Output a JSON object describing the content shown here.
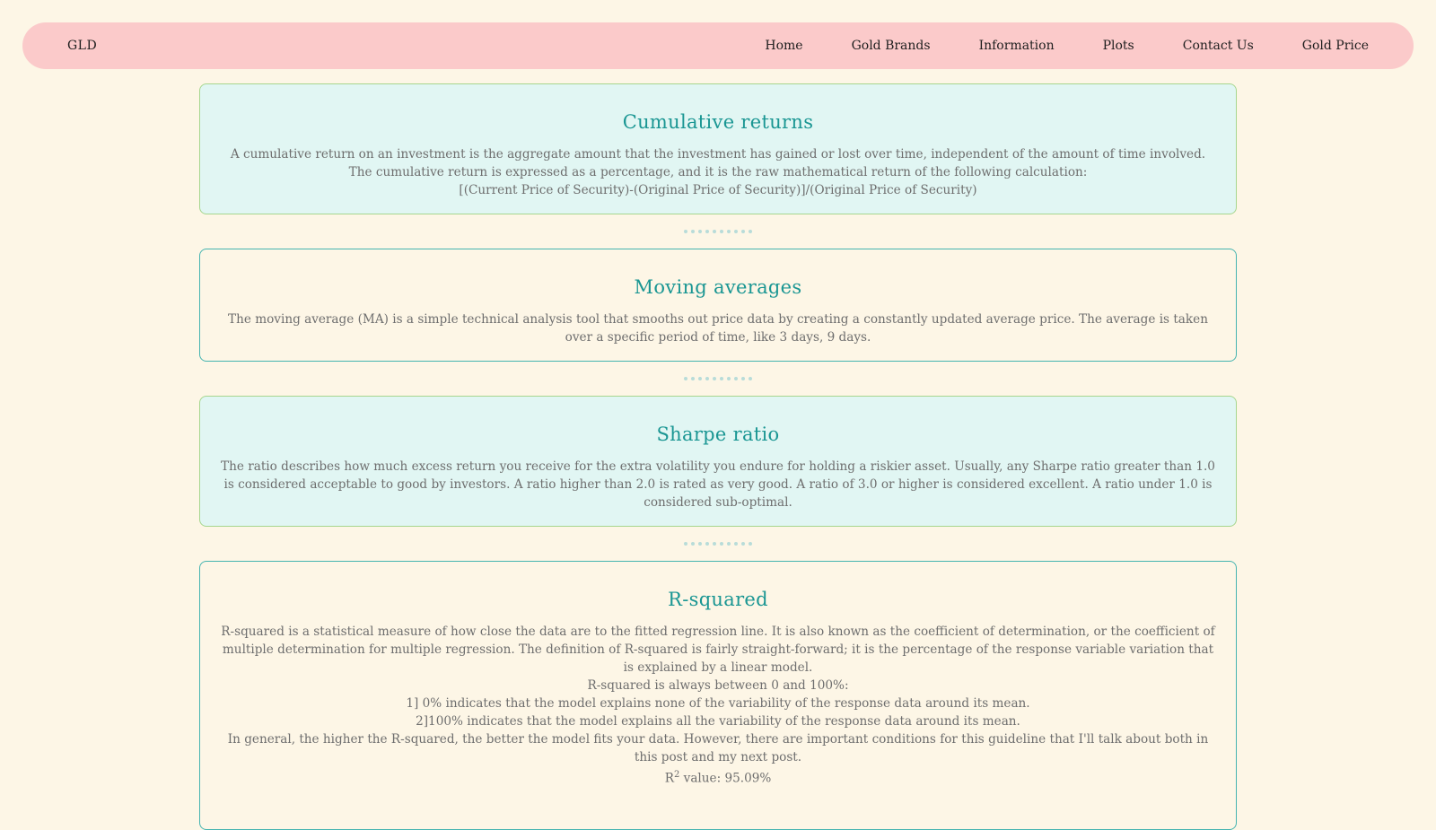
{
  "nav": {
    "brand": "GLD",
    "links": [
      "Home",
      "Gold Brands",
      "Information",
      "Plots",
      "Contact Us",
      "Gold Price"
    ]
  },
  "cards": {
    "cumulative": {
      "title": "Cumulative returns",
      "text": "A cumulative return on an investment is the aggregate amount that the investment has gained or lost over time, independent of the amount of time involved. The cumulative return is expressed as a percentage, and it is the raw mathematical return of the following calculation:",
      "formula": "[(Current Price of Security)-(Original Price of Security)]/(Original Price of Security)"
    },
    "moving": {
      "title": "Moving averages",
      "text": "The moving average (MA) is a simple technical analysis tool that smooths out price data by creating a constantly updated average price. The average is taken over a specific period of time, like 3 days, 9 days."
    },
    "sharpe": {
      "title": "Sharpe ratio",
      "text": "The ratio describes how much excess return you receive for the extra volatility you endure for holding a riskier asset. Usually, any Sharpe ratio greater than 1.0 is considered acceptable to good by investors. A ratio higher than 2.0 is rated as very good. A ratio of 3.0 or higher is considered excellent. A ratio under 1.0 is considered sub-optimal."
    },
    "rsquared": {
      "title": "R-squared",
      "text": "R-squared is a statistical measure of how close the data are to the fitted regression line. It is also known as the coefficient of determination, or the coefficient of multiple determination for multiple regression. The definition of R-squared is fairly straight-forward; it is the percentage of the response variable variation that is explained by a linear model.",
      "range": "R-squared is always between 0 and 100%:",
      "point1": "1] 0% indicates that the model explains none of the variability of the response data around its mean.",
      "point2": "2]100% indicates that the model explains all the variability of the response data around its mean.",
      "general": "In general, the higher the R-squared, the better the model fits your data. However, there are important conditions for this guideline that I'll talk about both in this post and my next post.",
      "value_prefix": "R",
      "value_sup": "2",
      "value_text": " value: 95.09%"
    }
  },
  "colors": {
    "page_bg": "#fdf6e6",
    "navbar_bg": "#fbcaca",
    "card_teal_bg": "#e1f6f3",
    "title": "#1a9693",
    "text": "#6e6e6e"
  }
}
